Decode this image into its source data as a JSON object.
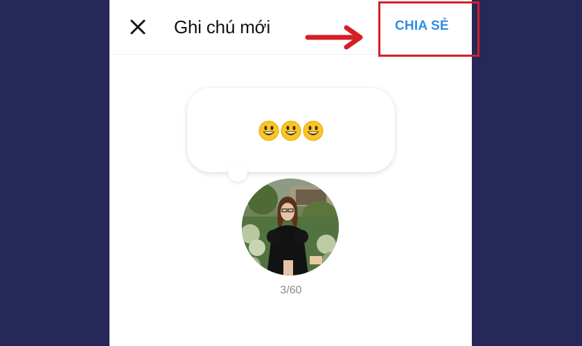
{
  "header": {
    "close_icon": "close-icon",
    "title": "Ghi chú mới",
    "share_label": "CHIA SẺ"
  },
  "note": {
    "text": "😀😀😀",
    "char_count": "3/60"
  },
  "annotation": {
    "arrow_color": "#d41f26",
    "box_color": "#d41f26"
  },
  "colors": {
    "background": "#262859",
    "accent": "#2f8ee3"
  }
}
